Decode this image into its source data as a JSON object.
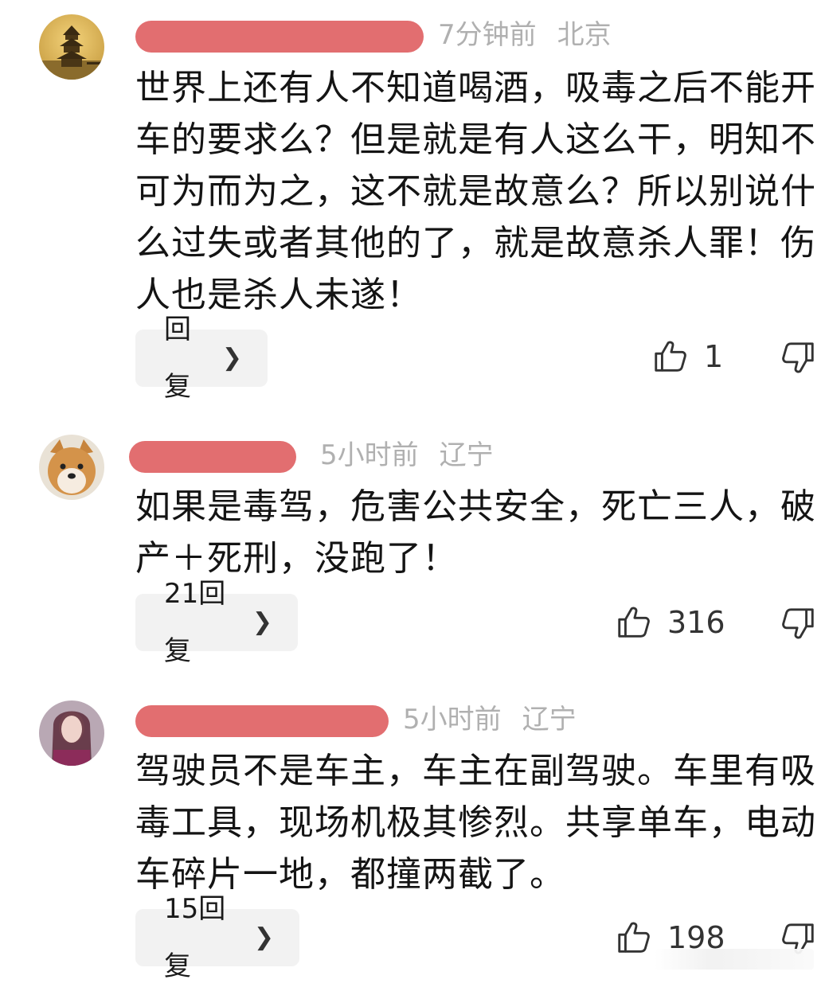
{
  "comments": [
    {
      "time": "7分钟前",
      "location": "北京",
      "text": "世界上还有人不知道喝酒，吸毒之后不能开车的要求么？但是就是有人这么干，明知不可为而为之，这不就是故意么？所以别说什么过失或者其他的了，就是故意杀人罪！伤人也是杀人未遂！",
      "reply_label": "回复",
      "likes": "1"
    },
    {
      "time": "5小时前",
      "location": "辽宁",
      "text": "如果是毒驾，危害公共安全，死亡三人，破产＋死刑，没跑了！",
      "reply_label": "21回复",
      "likes": "316"
    },
    {
      "time": "5小时前",
      "location": "辽宁",
      "text": "驾驶员不是车主，车主在副驾驶。车里有吸毒工具，现场机极其惨烈。共享单车，电动车碎片一地，都撞两截了。",
      "reply_label": "15回复",
      "likes": "198"
    }
  ],
  "icons": {
    "like": "thumbs-up-icon",
    "dislike": "thumbs-down-icon",
    "reply_chevron": "chevron-right-icon"
  },
  "colors": {
    "redaction": "#e26e70",
    "meta_text": "#b0b0b0",
    "reply_bg": "#f2f2f2"
  }
}
